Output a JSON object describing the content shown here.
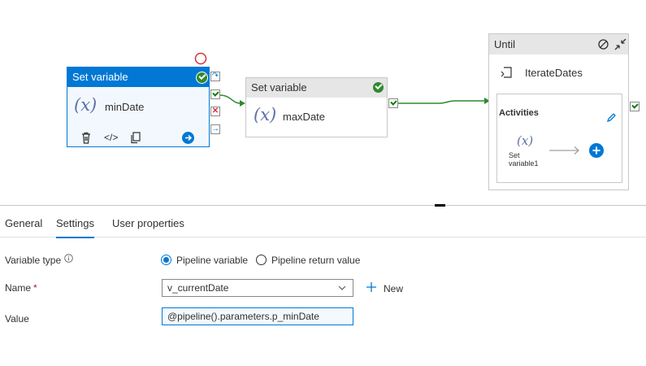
{
  "activities": {
    "min": {
      "title": "Set variable",
      "name": "minDate",
      "fx": "(x)"
    },
    "max": {
      "title": "Set variable",
      "name": "maxDate",
      "fx": "(x)"
    },
    "until": {
      "title": "Until",
      "name": "IterateDates",
      "activities_label": "Activities",
      "inner_fx": "(x)",
      "inner_label": "Set variable1"
    }
  },
  "tabs": [
    {
      "label": "General"
    },
    {
      "label": "Settings"
    },
    {
      "label": "User properties"
    }
  ],
  "form": {
    "variable_type": {
      "label": "Variable type",
      "options": [
        "Pipeline variable",
        "Pipeline return value"
      ],
      "selected": "Pipeline variable"
    },
    "name": {
      "label": "Name",
      "required_mark": "*",
      "value": "v_currentDate",
      "new_label": "New"
    },
    "value": {
      "label": "Value",
      "value": "@pipeline().parameters.p_minDate"
    }
  },
  "colors": {
    "accent": "#0078d4",
    "success": "#2f8a2f",
    "error": "#d13438",
    "selected_header": "#0078d4",
    "header_gray": "#e6e6e6"
  },
  "icons": [
    "check-circle-icon",
    "delete-icon",
    "code-icon",
    "copy-icon",
    "arrow-right-circle-icon",
    "skip-port-icon",
    "success-port-icon",
    "fail-port-icon",
    "complete-port-icon",
    "disable-icon",
    "collapse-icon",
    "loop-icon",
    "pencil-icon",
    "add-circle-icon",
    "info-icon",
    "chevron-down-icon",
    "plus-icon"
  ]
}
